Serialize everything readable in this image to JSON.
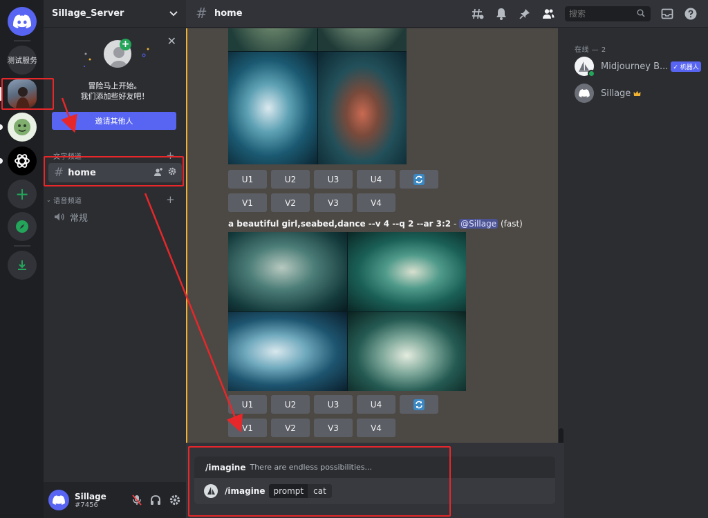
{
  "rail": {
    "test_server_label": "测试服务"
  },
  "server": {
    "name": "Sillage_Server"
  },
  "invite_card": {
    "line1": "冒险马上开始。",
    "line2": "我们添加些好友吧！",
    "button": "邀请其他人"
  },
  "categories": {
    "text": "文字频道",
    "voice": "语音频道"
  },
  "channels": {
    "home": "home",
    "voice_general": "常规"
  },
  "user": {
    "name": "Sillage",
    "tag": "#7456"
  },
  "topbar": {
    "channel": "home",
    "search_placeholder": "搜索"
  },
  "messages": {
    "grid1_buttons_u": [
      "U1",
      "U2",
      "U3",
      "U4"
    ],
    "grid1_buttons_v": [
      "V1",
      "V2",
      "V3",
      "V4"
    ],
    "prompt": "a beautiful girl,seabed,dance --v 4 --q 2 --ar 3:2",
    "prompt_sep": " - ",
    "mention": "@Sillage",
    "speed": "(fast)",
    "grid2_buttons_u": [
      "U1",
      "U2",
      "U3",
      "U4"
    ],
    "grid2_buttons_v": [
      "V1",
      "V2",
      "V3",
      "V4"
    ]
  },
  "composer": {
    "hint_command": "/imagine",
    "hint_desc": "There are endless possibilities...",
    "input_command": "/imagine",
    "option_key": "prompt",
    "option_value": "cat"
  },
  "members": {
    "heading": "在线 — 2",
    "list": [
      {
        "name": "Midjourney B...",
        "tag": "✓ 机器人"
      },
      {
        "name": "Sillage"
      }
    ]
  },
  "colors": {
    "blurple": "#5865f2",
    "online": "#23a55a",
    "annotation": "#e8272a"
  }
}
